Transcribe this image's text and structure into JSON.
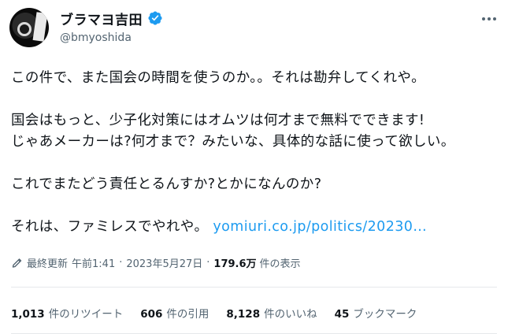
{
  "author": {
    "display_name": "ブラマヨ吉田",
    "handle": "@bmyoshida",
    "verified": true,
    "verified_color": "#1d9bf0"
  },
  "tweet": {
    "line1": "この件で、また国会の時間を使うのか。。それは勘弁してくれや。",
    "line2": "国会はもっと、少子化対策にはオムツは何才まで無料でできます!",
    "line3": "じゃあメーカーは?何才まで？みたいな、具体的な話に使って欲しい。",
    "line4": "これでまたどう責任とるんすか?とかになんのか?",
    "line5_text": "それは、ファミレスでやれや。",
    "line5_link": "yomiuri.co.jp/politics/20230…"
  },
  "meta": {
    "edited_label": "最終更新",
    "time": "午前1:41",
    "separator": "·",
    "date": "2023年5月27日",
    "views_value": "179.6万",
    "views_label": "件の表示"
  },
  "stats": {
    "retweets_value": "1,013",
    "retweets_label": "件のリツイート",
    "quotes_value": "606",
    "quotes_label": "件の引用",
    "likes_value": "8,128",
    "likes_label": "件のいいね",
    "bookmarks_value": "45",
    "bookmarks_label": "ブックマーク"
  },
  "icons": {
    "verified": "verified-badge-icon",
    "more": "more-options-icon",
    "edit": "edit-pencil-icon"
  }
}
